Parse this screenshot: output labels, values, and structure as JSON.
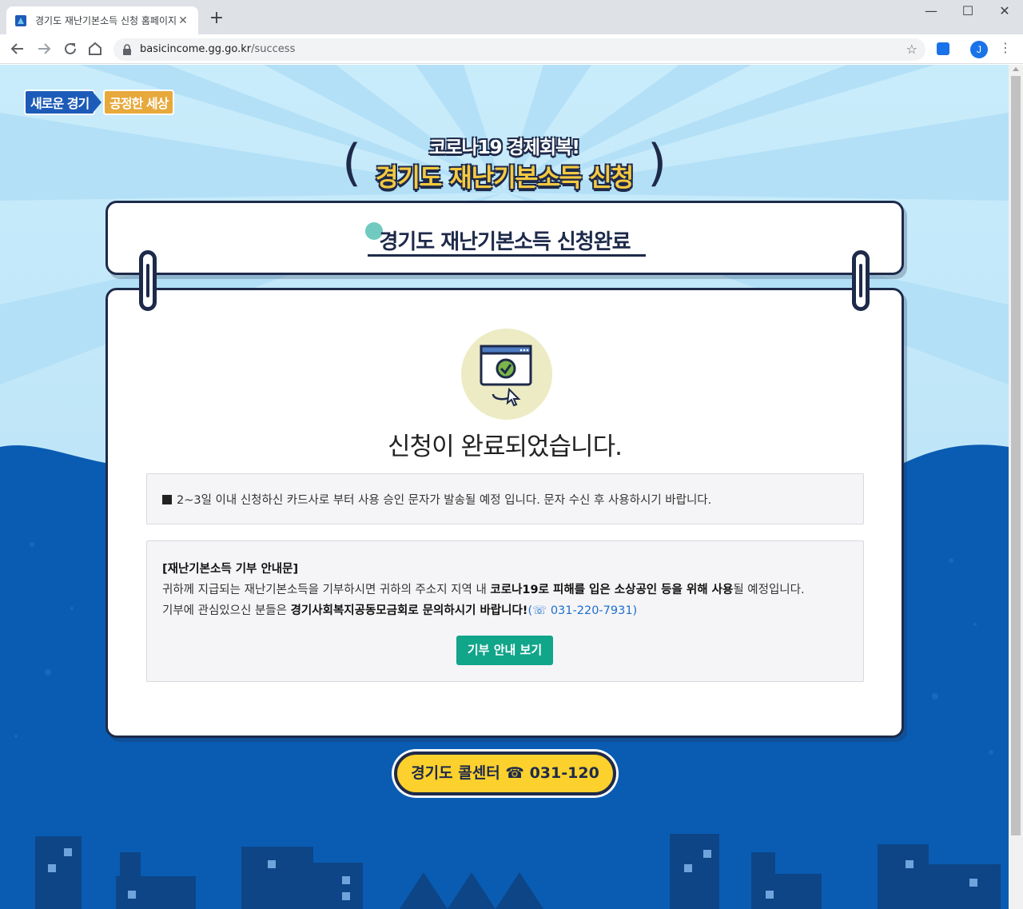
{
  "browser": {
    "tab_title": "경기도 재난기본소득 신청 홈페이지",
    "tab_close": "✕",
    "new_tab": "+",
    "window_controls": {
      "minimize": "—",
      "maximize": "☐",
      "close": "✕"
    },
    "url_host": "basicincome.gg.go.kr",
    "url_path": "/success",
    "profile_initial": "J"
  },
  "page": {
    "slogan": {
      "part1": "새로운 경기",
      "part2": "공정한 세상"
    },
    "headline": {
      "sub": "코로나19 경제회복!",
      "main": "경기도 재난기본소득 신청"
    },
    "board_title": "경기도 재난기본소득 신청완료",
    "complete_message": "신청이 완료되었습니다.",
    "notice1": "2~3일 이내 신청하신 카드사로 부터 사용 승인 문자가 발송될 예정 입니다. 문자 수신 후 사용하시기 바랍니다.",
    "notice2": {
      "heading": "[재난기본소득 기부 안내문]",
      "line1_a": "귀하께 지급되는 재난기본소득을 기부하시면 귀하의 주소지 지역 내 ",
      "line1_bold": "코로나19로 피해를 입은 소상공인 등을 위해 사용",
      "line1_c": "될 예정입니다.",
      "line2_a": "기부에 관심있으신 분들은 ",
      "line2_bold": "경기사회복지공동모금회로 문의하시기 바랍니다!",
      "line2_tel": "(☏ 031-220-7931)"
    },
    "donation_button": "기부 안내 보기",
    "call_center": "경기도 콜센터 ☎ 031-120"
  },
  "colors": {
    "navy": "#1e2a4a",
    "sky": "#c9ecfb",
    "ocean": "#0a5cb2",
    "yellow": "#fcd12d",
    "green_button": "#11a58a"
  },
  "icons": [
    "back-icon",
    "forward-icon",
    "reload-icon",
    "home-icon",
    "lock-icon",
    "star-icon",
    "menu-icon",
    "browser-window-check-icon",
    "cursor-icon"
  ]
}
